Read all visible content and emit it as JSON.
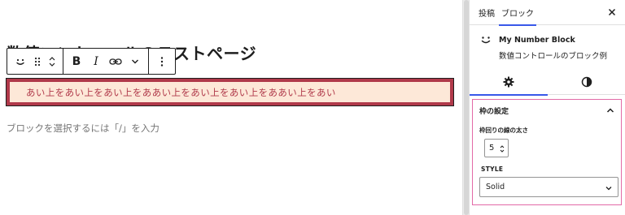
{
  "page": {
    "title": "数値コントロールのテストページ"
  },
  "block_toolbar": {
    "bold_label": "B",
    "italic_label": "I",
    "icons": [
      "smile-icon",
      "drag-handle-icon",
      "move-up-icon",
      "move-down-icon",
      "link-icon",
      "chevron-down-icon",
      "more-options-icon"
    ]
  },
  "selected_block": {
    "text": "あい上をあい上をあい上をああい上をあい上をあい上をああい上をあい",
    "border_color": "#b0394a",
    "background_color": "#fde8d8",
    "text_color": "#b0394a"
  },
  "editor": {
    "placeholder": "ブロックを選択するには「/」を入力"
  },
  "sidebar": {
    "tabs": [
      {
        "label": "投稿",
        "active": false
      },
      {
        "label": "ブロック",
        "active": true
      }
    ],
    "close_icon": "close-icon",
    "block": {
      "icon": "smile-icon",
      "name": "My Number Block",
      "description": "数値コントロールのブロック例"
    },
    "sub_tabs": [
      {
        "icon": "gear-icon",
        "active": true
      },
      {
        "icon": "contrast-icon",
        "active": false
      }
    ],
    "panel": {
      "title": "枠の設定",
      "expanded": true,
      "border_width_label": "枠回りの線の太さ",
      "border_width_value": "5",
      "style_label": "STYLE",
      "style_value": "Solid",
      "highlight_color": "#e26aa7"
    }
  },
  "accent_color": "#3858e9"
}
